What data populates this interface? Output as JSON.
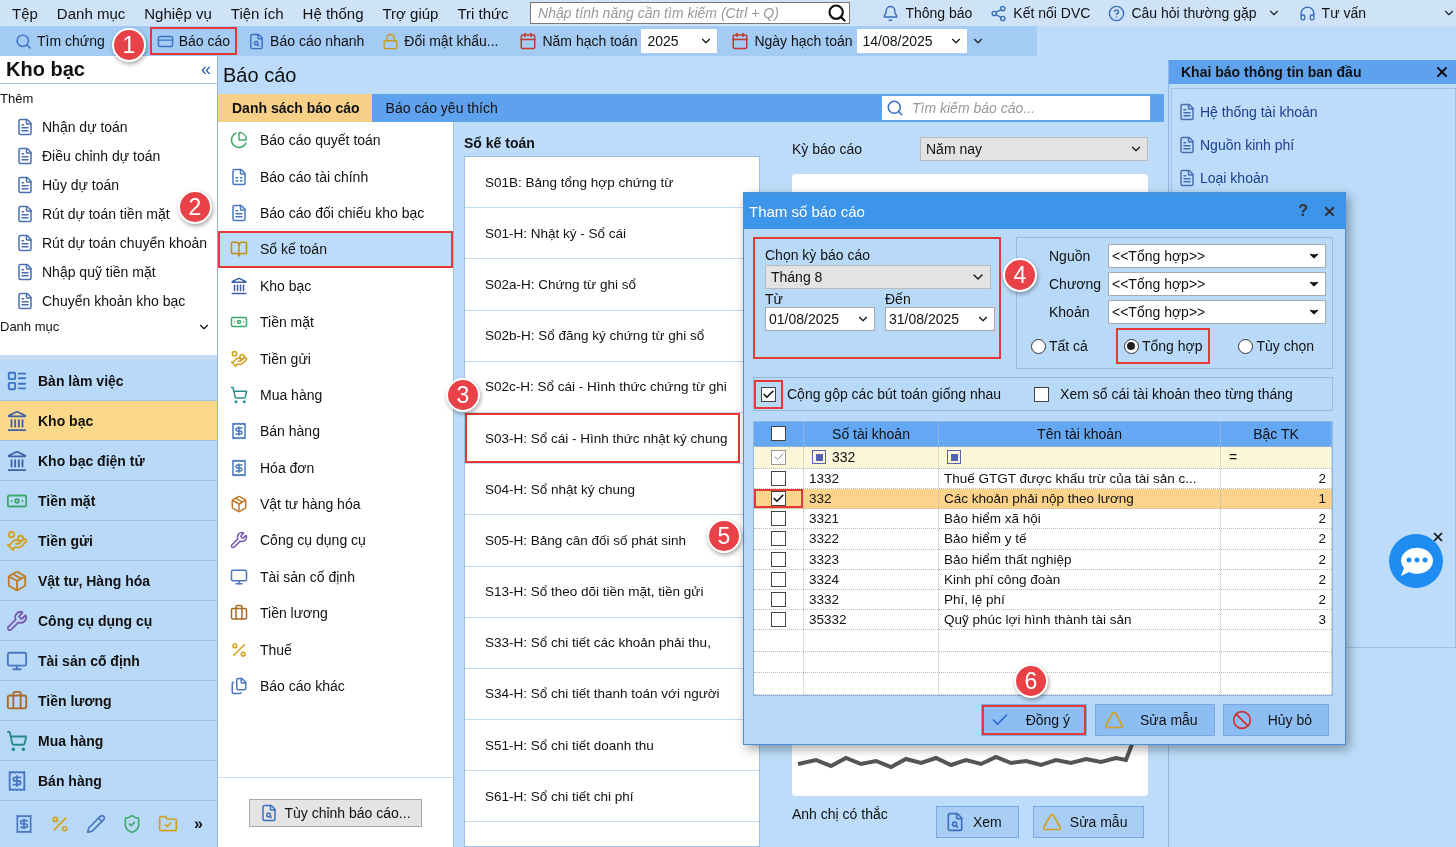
{
  "menu_bar": {
    "items": [
      "Tệp",
      "Danh mục",
      "Nghiệp vụ",
      "Tiện ích",
      "Hệ thống",
      "Trợ giúp",
      "Tri thức"
    ],
    "search": {
      "placeholder": "Nhập tính năng cần tìm kiếm (Ctrl + Q)"
    },
    "links": [
      {
        "label": "Thông báo",
        "kind": "bell",
        "dropdown": false
      },
      {
        "label": "Kết nối DVC",
        "kind": "network",
        "dropdown": false
      },
      {
        "label": "Câu hỏi thường gặp",
        "kind": "help",
        "dropdown": true
      },
      {
        "label": "Tư vấn",
        "kind": "headset",
        "dropdown": true
      }
    ]
  },
  "toolbar": {
    "buttons": [
      {
        "label": "Tìm chứng",
        "kind": "search",
        "highlighted": false
      },
      {
        "label": "Báo cáo",
        "kind": "report",
        "highlighted": true
      },
      {
        "label": "Báo cáo nhanh",
        "kind": "quick",
        "highlighted": false
      },
      {
        "label": "Đổi mật khẩu...",
        "kind": "lock",
        "highlighted": false
      }
    ],
    "year": {
      "label": "Năm hạch toán",
      "value": "2025"
    },
    "date": {
      "label": "Ngày hạch toán",
      "value": "14/08/2025"
    }
  },
  "sidebar": {
    "title": "Kho bạc",
    "collapse": "«",
    "add_section": "Thêm",
    "add_items": [
      "Nhận dự toán",
      "Điều chỉnh dự toán",
      "Hủy dự toán",
      "Rút dự toán tiền mặt",
      "Rút dự toán chuyển khoản",
      "Nhập quỹ tiền mặt",
      "Chuyển khoản kho bạc"
    ],
    "catalog_section": "Danh mục",
    "modules": [
      {
        "label": "Bàn làm việc",
        "selected": false
      },
      {
        "label": "Kho bạc",
        "selected": true
      },
      {
        "label": "Kho bạc điện tử",
        "selected": false
      },
      {
        "label": "Tiền mặt",
        "selected": false
      },
      {
        "label": "Tiền gửi",
        "selected": false
      },
      {
        "label": "Vật tư, Hàng hóa",
        "selected": false
      },
      {
        "label": "Công cụ dụng cụ",
        "selected": false
      },
      {
        "label": "Tài sản cố định",
        "selected": false
      },
      {
        "label": "Tiền lương",
        "selected": false
      },
      {
        "label": "Mua hàng",
        "selected": false
      },
      {
        "label": "Bán hàng",
        "selected": false
      }
    ],
    "more": "»"
  },
  "center": {
    "title": "Báo cáo",
    "tabs": [
      {
        "label": "Danh sách báo cáo",
        "selected": true
      },
      {
        "label": "Báo cáo yêu thích",
        "selected": false
      }
    ],
    "search": {
      "placeholder": "Tìm kiếm báo cáo..."
    },
    "categories": [
      {
        "label": "Báo cáo quyết toán",
        "selected": false,
        "highlighted": false
      },
      {
        "label": "Báo cáo tài chính",
        "selected": false,
        "highlighted": false
      },
      {
        "label": "Báo cáo đối chiếu kho bạc",
        "selected": false,
        "highlighted": false
      },
      {
        "label": "Sổ kế toán",
        "selected": true,
        "highlighted": true
      },
      {
        "label": "Kho bạc",
        "selected": false,
        "highlighted": false
      },
      {
        "label": "Tiền mặt",
        "selected": false,
        "highlighted": false
      },
      {
        "label": "Tiền gửi",
        "selected": false,
        "highlighted": false
      },
      {
        "label": "Mua hàng",
        "selected": false,
        "highlighted": false
      },
      {
        "label": "Bán hàng",
        "selected": false,
        "highlighted": false
      },
      {
        "label": "Hóa đơn",
        "selected": false,
        "highlighted": false
      },
      {
        "label": "Vật tư hàng hóa",
        "selected": false,
        "highlighted": false
      },
      {
        "label": "Công cụ dụng cụ",
        "selected": false,
        "highlighted": false
      },
      {
        "label": "Tài sản cố định",
        "selected": false,
        "highlighted": false
      },
      {
        "label": "Tiền lương",
        "selected": false,
        "highlighted": false
      },
      {
        "label": "Thuế",
        "selected": false,
        "highlighted": false
      },
      {
        "label": "Báo cáo khác",
        "selected": false,
        "highlighted": false
      }
    ],
    "customize_button": "Tùy chỉnh báo cáo...",
    "group_title": "Sổ kế toán",
    "reports": [
      {
        "label": "S01B: Bảng tổng hợp chứng từ",
        "highlighted": false
      },
      {
        "label": "S01-H: Nhật ký - Sổ cái",
        "highlighted": false
      },
      {
        "label": "S02a-H: Chứng từ ghi sổ",
        "highlighted": false
      },
      {
        "label": "S02b-H: Sổ đăng ký chứng từ ghi sổ",
        "highlighted": false
      },
      {
        "label": "S02c-H: Sổ cái - Hình thức chứng từ ghi",
        "highlighted": false
      },
      {
        "label": "S03-H: Sổ cái - Hình thức nhật ký chung",
        "highlighted": true
      },
      {
        "label": "S04-H: Sổ nhật ký chung",
        "highlighted": false
      },
      {
        "label": "S05-H: Bảng cân đối số phát sinh",
        "highlighted": false
      },
      {
        "label": "S13-H: Sổ theo dõi tiền mặt, tiền gửi",
        "highlighted": false
      },
      {
        "label": "S33-H: Sổ chi tiết các khoản phải thu,",
        "highlighted": false
      },
      {
        "label": "S34-H: Sổ chi tiết thanh toán với người",
        "highlighted": false
      },
      {
        "label": "S51-H: Sổ chi tiết doanh thu",
        "highlighted": false
      },
      {
        "label": "S61-H: Sổ chi tiết chi phí",
        "highlighted": false
      }
    ],
    "params": {
      "period_label": "Kỳ báo cáo",
      "period_value": "Năm nay",
      "note": "Anh chị có thắc",
      "buttons": [
        {
          "label": "Xem",
          "kind": "view"
        },
        {
          "label": "Sửa mẫu",
          "kind": "edit"
        }
      ]
    }
  },
  "right_panel": {
    "title": "Khai báo thông tin ban đầu",
    "items": [
      "Hệ thống tài khoản",
      "Nguồn kinh phí",
      "Loại khoản"
    ]
  },
  "dialog": {
    "title": "Tham số báo cáo",
    "help": "?",
    "period": {
      "label": "Chọn kỳ báo cáo",
      "value": "Tháng 8",
      "from_label": "Từ",
      "from": "01/08/2025",
      "to_label": "Đến",
      "to": "31/08/2025",
      "highlighted": true
    },
    "filters": [
      {
        "label": "Nguồn",
        "value": "<<Tổng hợp>>"
      },
      {
        "label": "Chương",
        "value": "<<Tổng hợp>>"
      },
      {
        "label": "Khoản",
        "value": "<<Tổng hợp>>"
      }
    ],
    "modes": [
      {
        "label": "Tất cả",
        "selected": false,
        "highlighted": false
      },
      {
        "label": "Tổng hợp",
        "selected": true,
        "highlighted": true
      },
      {
        "label": "Tùy chọn",
        "selected": false,
        "highlighted": false
      }
    ],
    "options": [
      {
        "label": "Cộng gộp các bút toán giống nhau",
        "checked": true,
        "highlighted": true
      },
      {
        "label": "Xem sổ cái tài khoản theo từng tháng",
        "checked": false,
        "highlighted": false
      }
    ],
    "table": {
      "columns": [
        "Số tài khoản",
        "Tên tài khoản",
        "Bậc TK"
      ],
      "all_checked": false,
      "filter": {
        "checked": true,
        "account": "332",
        "operator": "="
      },
      "rows": [
        {
          "account": "1332",
          "name": "Thuế GTGT được khấu trừ của tài sản c...",
          "rank": "2",
          "checked": false,
          "selected": false,
          "highlighted": false
        },
        {
          "account": "332",
          "name": "Các khoản phải nộp theo lương",
          "rank": "1",
          "checked": true,
          "selected": true,
          "highlighted": true
        },
        {
          "account": "3321",
          "name": "Bảo hiểm xã hội",
          "rank": "2",
          "checked": false,
          "selected": false,
          "highlighted": false
        },
        {
          "account": "3322",
          "name": "Bảo hiểm y tế",
          "rank": "2",
          "checked": false,
          "selected": false,
          "highlighted": false
        },
        {
          "account": "3323",
          "name": "Bảo hiểm thất nghiệp",
          "rank": "2",
          "checked": false,
          "selected": false,
          "highlighted": false
        },
        {
          "account": "3324",
          "name": "Kinh phí công đoàn",
          "rank": "2",
          "checked": false,
          "selected": false,
          "highlighted": false
        },
        {
          "account": "3332",
          "name": "Phí, lệ phí",
          "rank": "2",
          "checked": false,
          "selected": false,
          "highlighted": false
        },
        {
          "account": "35332",
          "name": "Quỹ phúc lợi hình thành tài sản",
          "rank": "3",
          "checked": false,
          "selected": false,
          "highlighted": false
        }
      ]
    },
    "buttons": [
      {
        "label": "Đồng ý",
        "kind": "ok",
        "highlighted": true
      },
      {
        "label": "Sửa mẫu",
        "kind": "edit",
        "highlighted": false
      },
      {
        "label": "Hủy bỏ",
        "kind": "cancel",
        "highlighted": false
      }
    ]
  },
  "annotations": [
    "1",
    "2",
    "3",
    "4",
    "5",
    "6"
  ]
}
